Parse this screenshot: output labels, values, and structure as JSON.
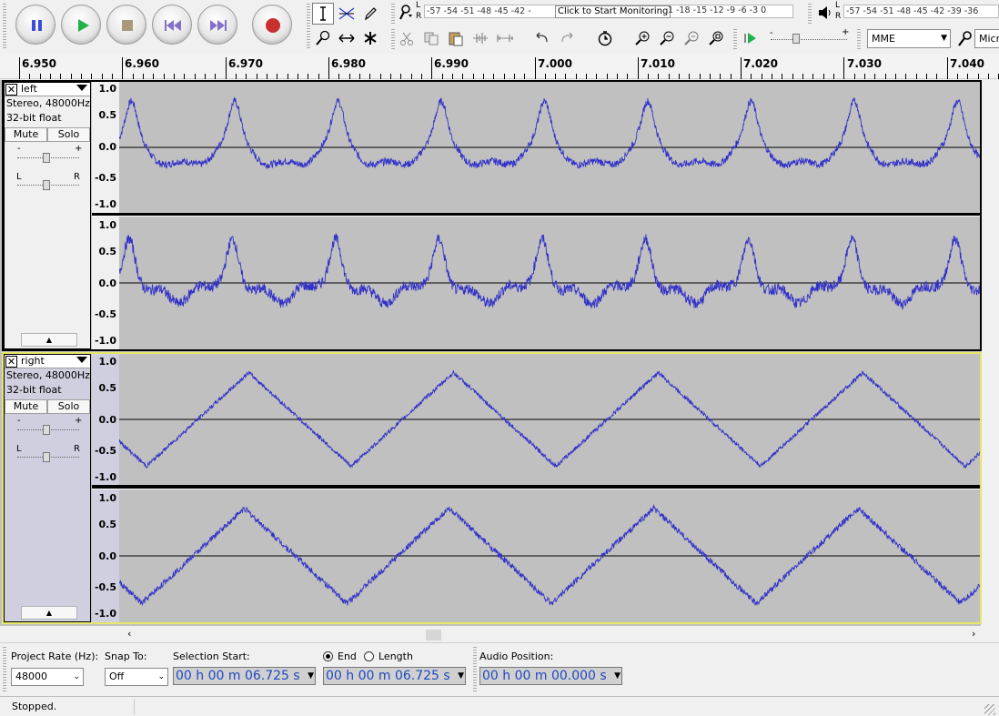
{
  "transport": {
    "buttons": [
      {
        "name": "pause-button",
        "icon": "pause-icon"
      },
      {
        "name": "play-button",
        "icon": "play-icon"
      },
      {
        "name": "stop-button",
        "icon": "stop-icon"
      },
      {
        "name": "skip-to-start-button",
        "icon": "skip-start-icon"
      },
      {
        "name": "skip-to-end-button",
        "icon": "skip-end-icon"
      },
      {
        "name": "record-button",
        "icon": "record-icon"
      }
    ]
  },
  "meters": {
    "record_scale": "-57 -54 -51 -48 -45 -42 -",
    "record_click": "Click to Start Monitoring",
    "record_scale_tail": "1 -18 -15 -12  -9  -6  -3  0",
    "play_scale": "-57 -54 -51 -48 -45 -42 -39 -36",
    "lr_l": "L",
    "lr_r": "R"
  },
  "device": {
    "host": "MME",
    "mic_label": "Micr"
  },
  "ruler": {
    "ticks": [
      "6.950",
      "6.960",
      "6.970",
      "6.980",
      "6.990",
      "7.000",
      "7.010",
      "7.020",
      "7.030",
      "7.040"
    ]
  },
  "tracks": [
    {
      "name": "left",
      "format": "Stereo, 48000Hz",
      "bits": "32-bit float",
      "mute": "Mute",
      "solo": "Solo",
      "gain_minus": "-",
      "gain_plus": "+",
      "pan_l": "L",
      "pan_r": "R",
      "selected": false,
      "scale": [
        "1.0",
        "0.5",
        "0.0",
        "-0.5",
        "-1.0"
      ]
    },
    {
      "name": "right",
      "format": "Stereo, 48000Hz",
      "bits": "32-bit float",
      "mute": "Mute",
      "solo": "Solo",
      "gain_minus": "-",
      "gain_plus": "+",
      "pan_l": "L",
      "pan_r": "R",
      "selected": true,
      "scale": [
        "1.0",
        "0.5",
        "0.0",
        "-0.5",
        "-1.0"
      ]
    }
  ],
  "selection_bar": {
    "project_rate_label": "Project Rate (Hz):",
    "project_rate_value": "48000",
    "snap_to_label": "Snap To:",
    "snap_to_value": "Off",
    "selection_start_label": "Selection Start:",
    "end_label": "End",
    "length_label": "Length",
    "end_selected": true,
    "selection_start": "00 h 00 m 06.725 s",
    "selection_end": "00 h 00 m 06.725 s",
    "audio_position_label": "Audio Position:",
    "audio_position": "00 h 00 m 00.000 s"
  },
  "status": {
    "text": "Stopped."
  }
}
